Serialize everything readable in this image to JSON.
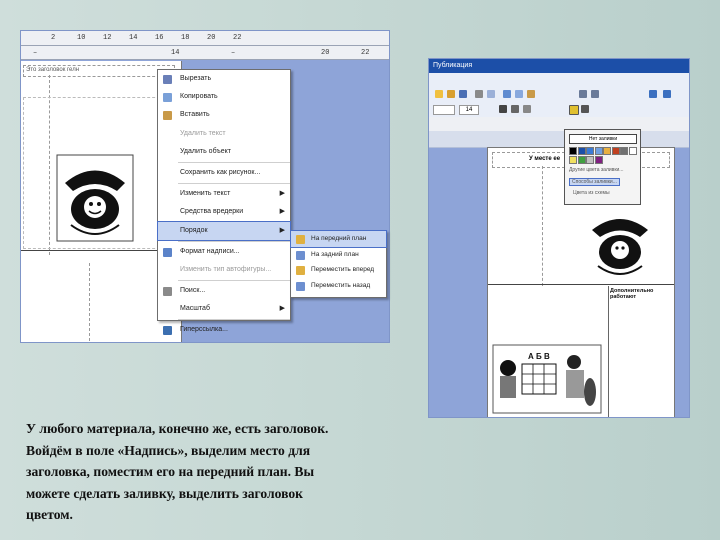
{
  "left_window": {
    "text_box_label": "Это заголовок гелн",
    "context_menu": [
      {
        "label": "Вырезать",
        "icon": "scissors-icon",
        "disabled": false
      },
      {
        "label": "Копировать",
        "icon": "copy-icon",
        "disabled": false
      },
      {
        "label": "Вставить",
        "icon": "paste-icon",
        "disabled": false
      },
      {
        "label": "Удалить текст",
        "icon": "",
        "disabled": true
      },
      {
        "label": "Удалить объект",
        "icon": "",
        "disabled": false
      },
      {
        "label": "Сохранить как рисунок...",
        "icon": "",
        "disabled": false,
        "separator_before": true
      },
      {
        "label": "Изменить текст",
        "icon": "",
        "disabled": false,
        "submenu": true
      },
      {
        "label": "Средства вредерки",
        "icon": "",
        "disabled": false,
        "submenu": true
      },
      {
        "label": "Порядок",
        "icon": "",
        "disabled": false,
        "submenu": true,
        "highlighted": true
      },
      {
        "label": "Формат надписи...",
        "icon": "format-icon",
        "disabled": false,
        "separator_before": true
      },
      {
        "label": "Изменить тип автофигуры...",
        "icon": "",
        "disabled": true
      },
      {
        "label": "Поиск...",
        "icon": "search-icon",
        "disabled": false,
        "separator_before": true
      },
      {
        "label": "Масштаб",
        "icon": "",
        "disabled": false,
        "submenu": true
      },
      {
        "label": "Гиперссылка...",
        "icon": "hyperlink-icon",
        "disabled": false,
        "separator_before": true
      }
    ],
    "order_submenu": [
      {
        "label": "На передний план",
        "highlighted": true
      },
      {
        "label": "На задний план",
        "highlighted": false
      },
      {
        "label": "Переместить вперед",
        "highlighted": false
      },
      {
        "label": "Переместить назад",
        "highlighted": false
      }
    ]
  },
  "right_window": {
    "title": "Публикация",
    "font_size": "14",
    "document_heading": "У месте ее",
    "palette_menu": {
      "no_fill": "Нет заливки",
      "more_colors": "Другие цвета заливки...",
      "fill_effects": "Способы заливки...",
      "sample_colors": "Цвета из схемы"
    },
    "side_text": "Дополнительно работают"
  },
  "colors": {
    "accent": "#4a6fc7",
    "title_bar": "#1c4fa8",
    "screen_bg": "#8ea4d8",
    "palette": [
      "#000000",
      "#1c4fa8",
      "#3b7bd6",
      "#70a0e0",
      "#e8b040",
      "#c04020",
      "#707070",
      "#ffffff",
      "#f0e060",
      "#40a040",
      "#c0c0c0",
      "#802080"
    ]
  },
  "caption": {
    "lines": [
      "У любого материала, конечно же, есть заголовок.",
      "Войдём в поле «Надпись», выделим место для",
      "заголовка, поместим его на передний план. Вы",
      "можете сделать заливку, выделить заголовок",
      "цветом."
    ]
  }
}
